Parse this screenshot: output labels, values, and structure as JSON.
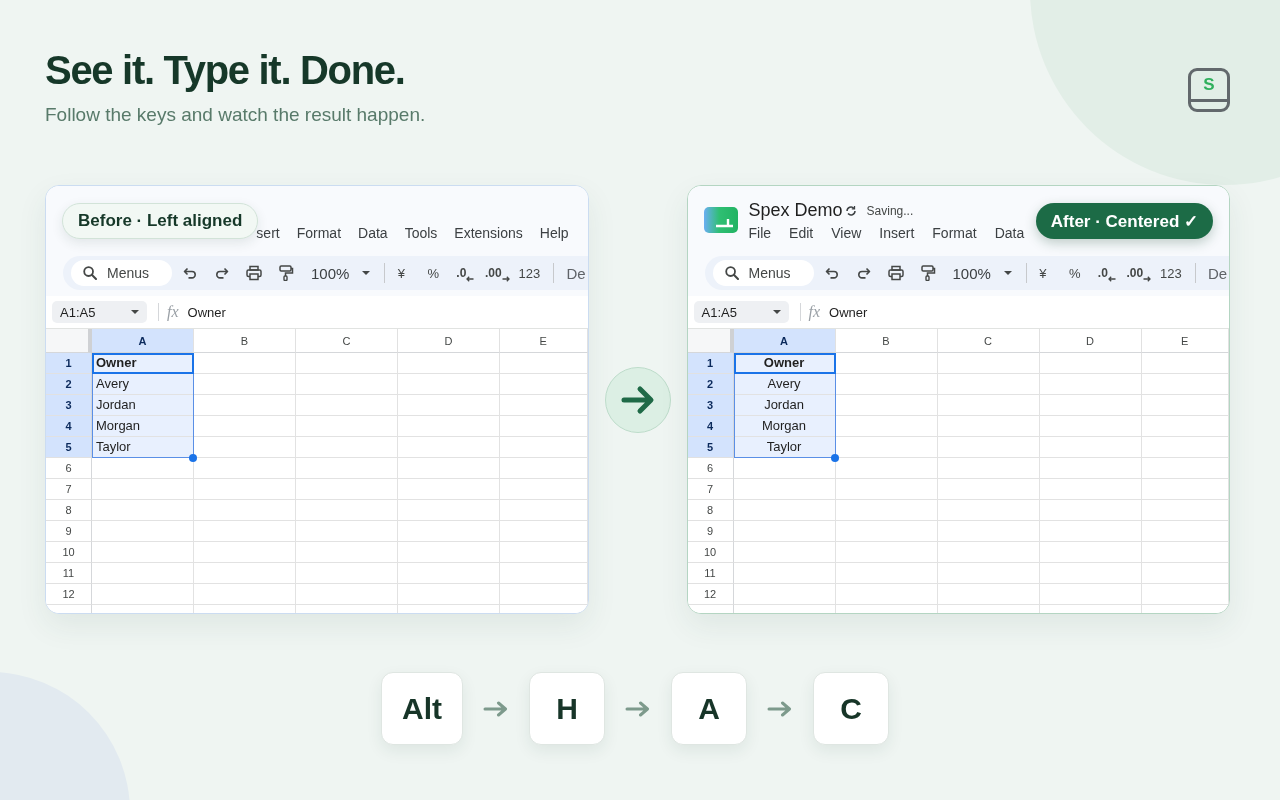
{
  "heading": {
    "title": "See it. Type it. Done.",
    "subtitle": "Follow the keys and watch the result happen."
  },
  "logo": {
    "letter": "S"
  },
  "panels": [
    {
      "kind": "before",
      "badge": "Before · Left aligned",
      "centered": false,
      "menu": [
        "sert",
        "Format",
        "Data",
        "Tools",
        "Extensions",
        "Help"
      ],
      "toolbar": {
        "search_placeholder": "Menus",
        "zoom": "100%",
        "format_buttons": [
          {
            "label": "¥",
            "kind": "text"
          },
          {
            "label": "%",
            "kind": "text"
          },
          {
            "label": ".0",
            "kind": "decrease"
          },
          {
            "label": ".00",
            "kind": "increase"
          },
          {
            "label": "123",
            "kind": "text"
          }
        ],
        "font": "De"
      },
      "formula_bar": {
        "name_box": "A1:A5",
        "function_label": "fx",
        "value": "Owner"
      },
      "grid": {
        "columns": [
          {
            "label": "A",
            "selected": true
          },
          {
            "label": "B",
            "selected": false
          },
          {
            "label": "C",
            "selected": false
          },
          {
            "label": "D",
            "selected": false
          },
          {
            "label": "E",
            "selected": false
          }
        ],
        "rows": [
          {
            "label": "1",
            "selected": true,
            "cells": [
              {
                "text": "Owner",
                "bold": true,
                "active": true
              }
            ]
          },
          {
            "label": "2",
            "selected": true,
            "cells": [
              {
                "text": "Avery",
                "bold": false,
                "active": false
              }
            ]
          },
          {
            "label": "3",
            "selected": true,
            "cells": [
              {
                "text": "Jordan",
                "bold": false,
                "active": false
              }
            ]
          },
          {
            "label": "4",
            "selected": true,
            "cells": [
              {
                "text": "Morgan",
                "bold": false,
                "active": false
              }
            ]
          },
          {
            "label": "5",
            "selected": true,
            "cells": [
              {
                "text": "Taylor",
                "bold": false,
                "active": false
              }
            ]
          },
          {
            "label": "6",
            "selected": false
          },
          {
            "label": "7",
            "selected": false
          },
          {
            "label": "8",
            "selected": false
          },
          {
            "label": "9",
            "selected": false
          },
          {
            "label": "10",
            "selected": false
          },
          {
            "label": "11",
            "selected": false
          },
          {
            "label": "12",
            "selected": false
          }
        ]
      }
    },
    {
      "kind": "after",
      "badge": "After · Centered ✓",
      "centered": true,
      "document": {
        "title": "Spex Demo",
        "status": "Saving..."
      },
      "menu": [
        "File",
        "Edit",
        "View",
        "Insert",
        "Format",
        "Data"
      ],
      "toolbar": {
        "search_placeholder": "Menus",
        "zoom": "100%",
        "format_buttons": [
          {
            "label": "¥",
            "kind": "text"
          },
          {
            "label": "%",
            "kind": "text"
          },
          {
            "label": ".0",
            "kind": "decrease"
          },
          {
            "label": ".00",
            "kind": "increase"
          },
          {
            "label": "123",
            "kind": "text"
          }
        ],
        "font": "De"
      },
      "formula_bar": {
        "name_box": "A1:A5",
        "function_label": "fx",
        "value": "Owner"
      },
      "grid": {
        "columns": [
          {
            "label": "A",
            "selected": true
          },
          {
            "label": "B",
            "selected": false
          },
          {
            "label": "C",
            "selected": false
          },
          {
            "label": "D",
            "selected": false
          },
          {
            "label": "E",
            "selected": false
          }
        ],
        "rows": [
          {
            "label": "1",
            "selected": true,
            "cells": [
              {
                "text": "Owner",
                "bold": true,
                "active": true
              }
            ]
          },
          {
            "label": "2",
            "selected": true,
            "cells": [
              {
                "text": "Avery",
                "bold": false,
                "active": false
              }
            ]
          },
          {
            "label": "3",
            "selected": true,
            "cells": [
              {
                "text": "Jordan",
                "bold": false,
                "active": false
              }
            ]
          },
          {
            "label": "4",
            "selected": true,
            "cells": [
              {
                "text": "Morgan",
                "bold": false,
                "active": false
              }
            ]
          },
          {
            "label": "5",
            "selected": true,
            "cells": [
              {
                "text": "Taylor",
                "bold": false,
                "active": false
              }
            ]
          },
          {
            "label": "6",
            "selected": false
          },
          {
            "label": "7",
            "selected": false
          },
          {
            "label": "8",
            "selected": false
          },
          {
            "label": "9",
            "selected": false
          },
          {
            "label": "10",
            "selected": false
          },
          {
            "label": "11",
            "selected": false
          },
          {
            "label": "12",
            "selected": false
          }
        ]
      }
    }
  ],
  "shortcut": {
    "keys": [
      "Alt",
      "H",
      "A",
      "C"
    ]
  }
}
